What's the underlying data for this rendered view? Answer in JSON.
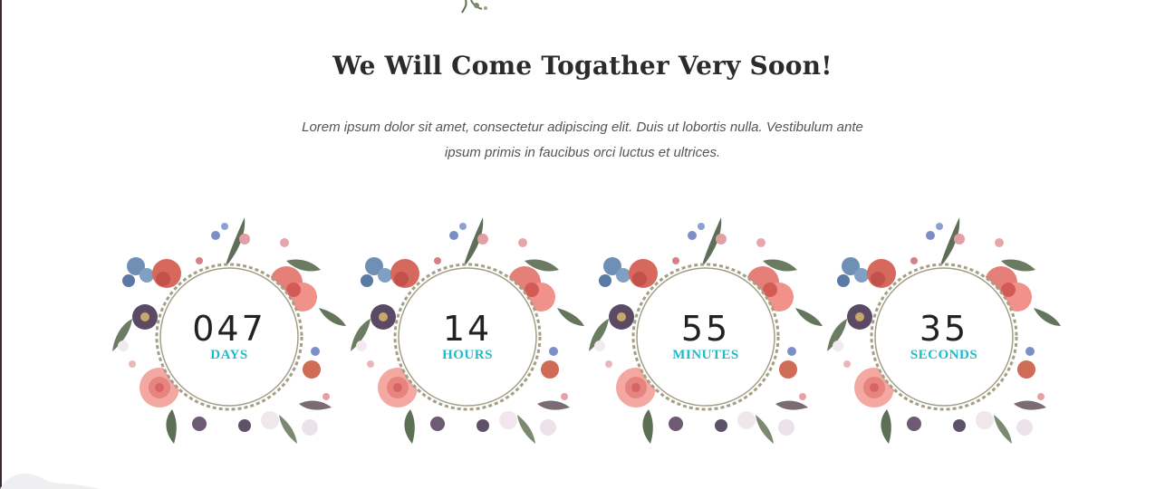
{
  "section": {
    "title": "We Will Come Togather Very Soon!",
    "description": "Lorem ipsum dolor sit amet, consectetur adipiscing elit. Duis ut lobortis nulla. Vestibulum ante ipsum primis in faucibus orci luctus et ultrices."
  },
  "countdown": [
    {
      "value": "047",
      "unit": "DAYS"
    },
    {
      "value": "14",
      "unit": "HOURS"
    },
    {
      "value": "55",
      "unit": "MINUTES"
    },
    {
      "value": "35",
      "unit": "SECONDS"
    }
  ],
  "colors": {
    "unit_accent": "#1bbccc",
    "title_text": "#2b2b2b",
    "frame": "#a39e86"
  },
  "icons": [
    "floral-wreath-icon",
    "floral-sprig-icon",
    "leaf-corner-icon"
  ]
}
